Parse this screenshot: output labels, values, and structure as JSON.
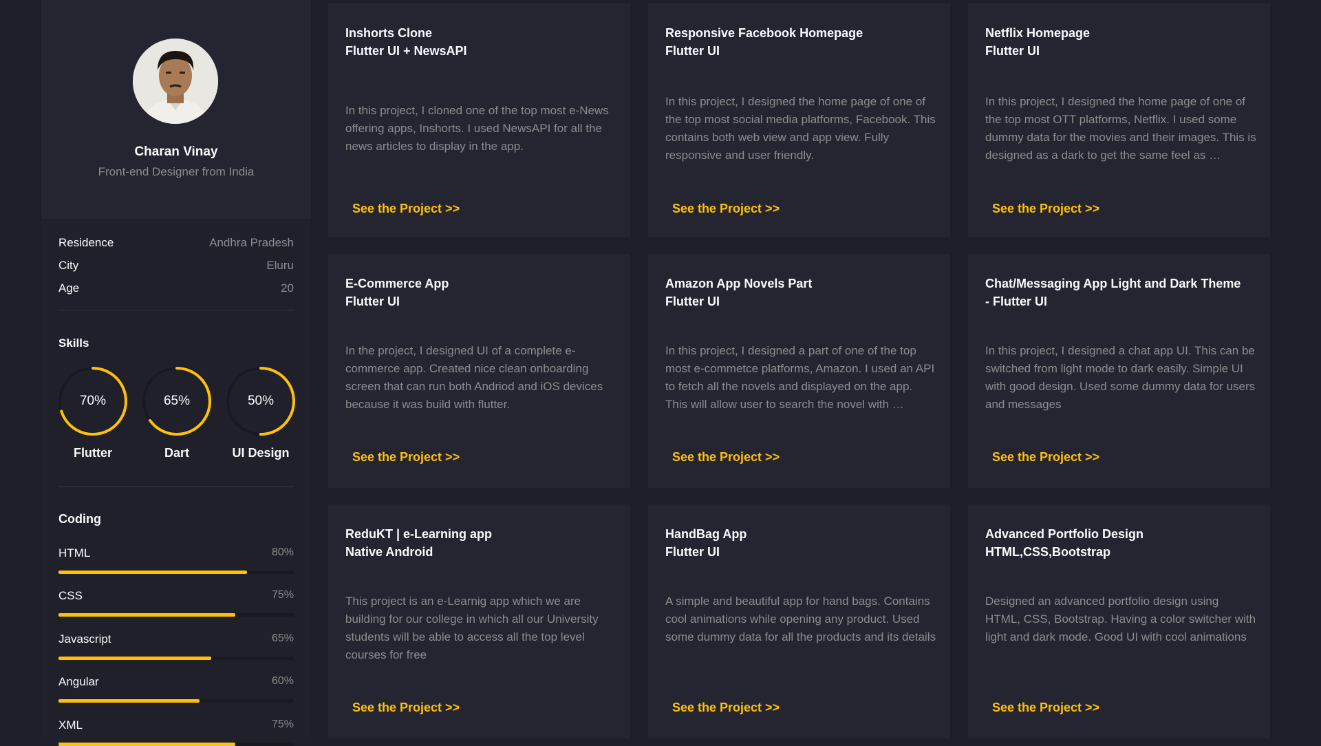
{
  "profile": {
    "name": "Charan Vinay",
    "role": "Front-end Designer from India"
  },
  "info": [
    {
      "key": "Residence",
      "value": "Andhra Pradesh"
    },
    {
      "key": "City",
      "value": "Eluru"
    },
    {
      "key": "Age",
      "value": "20"
    }
  ],
  "skills": {
    "title": "Skills",
    "items": [
      {
        "label": "Flutter",
        "percent_text": "70%",
        "level": 0.7
      },
      {
        "label": "Dart",
        "percent_text": "65%",
        "level": 0.65
      },
      {
        "label": "UI Design",
        "percent_text": "50%",
        "level": 0.5
      }
    ]
  },
  "coding": {
    "title": "Coding",
    "items": [
      {
        "label": "HTML",
        "percent_text": "80%",
        "level": 0.8
      },
      {
        "label": "CSS",
        "percent_text": "75%",
        "level": 0.75
      },
      {
        "label": "Javascript",
        "percent_text": "65%",
        "level": 0.65
      },
      {
        "label": "Angular",
        "percent_text": "60%",
        "level": 0.6
      },
      {
        "label": "XML",
        "percent_text": "75%",
        "level": 0.75
      }
    ]
  },
  "projects": [
    {
      "title_line1": "Inshorts Clone",
      "title_line2": "Flutter UI + NewsAPI",
      "description": "In this project, I cloned one of the top most e-News offering apps, Inshorts. I used NewsAPI for all the news articles to display in the app.",
      "link": "See the Project >>"
    },
    {
      "title_line1": "Responsive Facebook Homepage",
      "title_line2": "Flutter UI",
      "description": "In this project, I designed the home page of one of the top most social media platforms, Facebook. This contains both web view and app view. Fully responsive and user friendly.",
      "link": "See the Project >>"
    },
    {
      "title_line1": "Netflix Homepage",
      "title_line2": "Flutter UI",
      "description": "In this project, I designed the home page of one of the top most OTT platforms, Netflix. I used some dummy data for the movies and their images. This is designed as a dark to get the same feel as …",
      "link": "See the Project >>"
    },
    {
      "title_line1": "E-Commerce App",
      "title_line2": "Flutter UI",
      "description": "In the project, I designed UI of a complete e-commerce app. Created nice clean onboarding screen that can run both Andriod and iOS devices because it was build with flutter.",
      "link": "See the Project >>"
    },
    {
      "title_line1": "Amazon App Novels Part",
      "title_line2": "Flutter UI",
      "description": "In this project, I designed a part of one of the top most e-commetce platforms, Amazon. I used an API to fetch all the novels and displayed on the app. This will allow user to search the novel with …",
      "link": "See the Project >>"
    },
    {
      "title_line1": "Chat/Messaging App Light and Dark Theme",
      "title_line2": "- Flutter UI",
      "description": "In this project, I designed a chat app UI. This can be switched from light mode to dark easily. Simple UI with good design. Used some dummy data for users and messages",
      "link": "See the Project >>"
    },
    {
      "title_line1": "ReduKT | e-Learning app",
      "title_line2": "Native Android",
      "description": "This project is an e-Learnig app which we are building for our college in which all our University students will be able to access all the top level courses for free",
      "link": "See the Project >>"
    },
    {
      "title_line1": "HandBag App",
      "title_line2": "Flutter UI",
      "description": "A simple and beautiful app for hand bags. Contains cool animations while opening any product. Used some dummy data for all the products and its details",
      "link": "See the Project >>"
    },
    {
      "title_line1": "Advanced Portfolio Design",
      "title_line2": "HTML,CSS,Bootstrap",
      "description": "Designed an advanced portfolio design using HTML, CSS, Bootstrap. Having a color switcher with light and dark mode. Good UI with cool animations",
      "link": "See the Project >>"
    }
  ],
  "colors": {
    "accent": "#ffc107",
    "background": "#1e1e28",
    "card": "#252532",
    "muted_text": "#8c8c8e"
  }
}
